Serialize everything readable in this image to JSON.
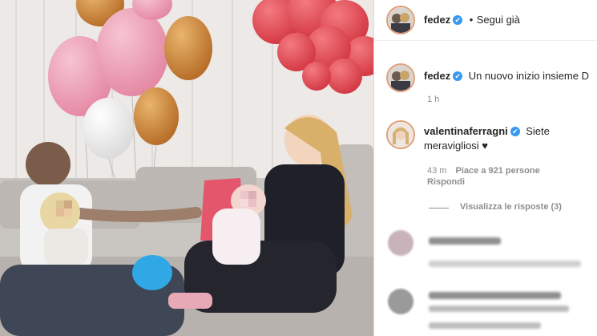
{
  "post": {
    "author": "fedez",
    "follow_status": "Segui già",
    "dot": "•"
  },
  "caption": {
    "author": "fedez",
    "text": "Un nuovo inizio insieme D",
    "time": "1 h"
  },
  "comment": {
    "author": "valentinaferragni",
    "text": "Siete meravigliosi ♥",
    "time": "43 m",
    "likes": "Piace a 921 persone",
    "reply": "Rispondi",
    "view_replies": "Visualizza le risposte (3)"
  },
  "icons": {
    "verified": "✔"
  },
  "colors": {
    "verified_blue": "#3897f0",
    "text": "#262626",
    "meta": "#8e8e8e"
  }
}
